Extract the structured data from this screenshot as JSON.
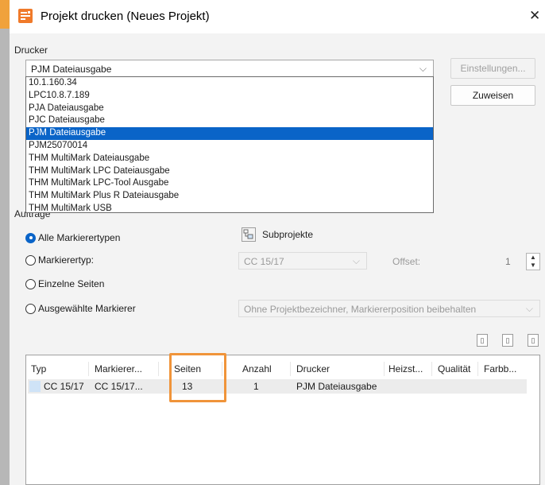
{
  "window": {
    "title": "Projekt drucken (Neues Projekt)",
    "close_glyph": "✕"
  },
  "drucker": {
    "label": "Drucker",
    "selected": "PJM Dateiausgabe",
    "settings_button": "Einstellungen...",
    "assign_button": "Zuweisen",
    "options": [
      "10.1.160.34",
      "LPC10.8.7.189",
      "PJA Dateiausgabe",
      "PJC Dateiausgabe",
      "PJM Dateiausgabe",
      "PJM25070014",
      "THM MultiMark Dateiausgabe",
      "THM MultiMark LPC Dateiausgabe",
      "THM MultiMark LPC-Tool Ausgabe",
      "THM MultiMark Plus R Dateiausgabe",
      "THM MultiMark USB"
    ],
    "selected_index": 4
  },
  "auftraege": {
    "label": "Aufträge",
    "radios": {
      "alle": "Alle Markierertypen",
      "markierertyp": "Markierertyp:",
      "einzelne": "Einzelne Seiten",
      "ausgewaehlte": "Ausgewählte Markierer"
    },
    "subprojekte": "Subprojekte",
    "markierertyp_value": "CC 15/17",
    "offset_label": "Offset:",
    "offset_value": "1",
    "ausgewaehlte_value": "Ohne Projektbezeichner, Markiererposition beibehalten"
  },
  "table": {
    "headers": [
      "Typ",
      "Markierer...",
      "Seiten",
      "Anzahl",
      "Drucker",
      "Heizst...",
      "Qualität",
      "Farbb..."
    ],
    "rows": [
      {
        "typ": "CC 15/17",
        "markierer": "CC 15/17...",
        "seiten": "13",
        "anzahl": "1",
        "drucker": "PJM Dateiausgabe"
      }
    ]
  },
  "colors": {
    "selection": "#0a64c8",
    "highlight": "#f0943a"
  }
}
